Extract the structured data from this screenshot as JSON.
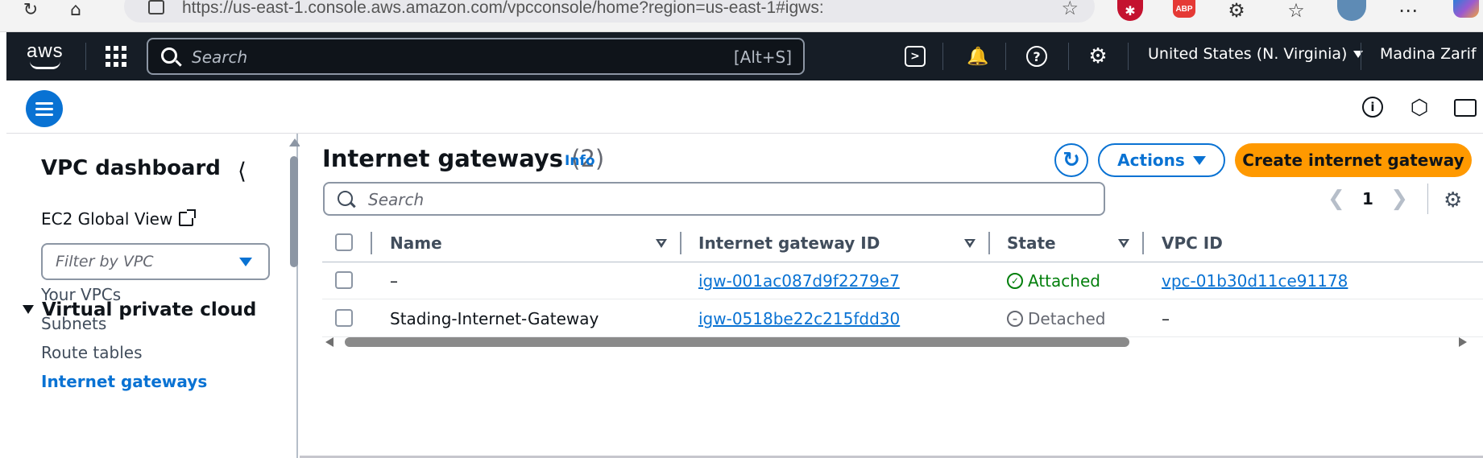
{
  "browser": {
    "url": "https://us-east-1.console.aws.amazon.com/vpcconsole/home?region=us-east-1#igws:",
    "abp_label": "ABP",
    "icons": [
      "refresh-icon",
      "home-icon",
      "site-info-icon",
      "favorite-star-icon",
      "extension-icon",
      "favorites-icon",
      "profile-avatar",
      "more-icon",
      "copilot-icon"
    ]
  },
  "topnav": {
    "logo": "aws",
    "search_placeholder": "Search",
    "search_shortcut": "[Alt+S]",
    "region": "United States (N. Virginia)",
    "user": "Madina Zarif"
  },
  "sidebar": {
    "title": "VPC dashboard",
    "ec2_global_view": "EC2 Global View",
    "filter_placeholder": "Filter by VPC",
    "section": "Virtual private cloud",
    "items": [
      {
        "label": "Your VPCs",
        "active": false
      },
      {
        "label": "Subnets",
        "active": false
      },
      {
        "label": "Route tables",
        "active": false
      },
      {
        "label": "Internet gateways",
        "active": true
      }
    ]
  },
  "main": {
    "title": "Internet gateways",
    "count": "(2)",
    "info": "Info",
    "actions_label": "Actions",
    "create_label": "Create internet gateway",
    "search_placeholder": "Search",
    "page": "1",
    "columns": [
      "Name",
      "Internet gateway ID",
      "State",
      "VPC ID"
    ],
    "rows": [
      {
        "name": "–",
        "igw_id": "igw-001ac087d9f2279e7",
        "state": "Attached",
        "state_icon": "check-circle-icon",
        "vpc_id": "vpc-01b30d11ce91178"
      },
      {
        "name": "Stading-Internet-Gateway",
        "igw_id": "igw-0518be22c215fdd30",
        "state": "Detached",
        "state_icon": "minus-circle-icon",
        "vpc_id": "–"
      }
    ]
  },
  "colors": {
    "nav_bg": "#161d26",
    "accent_blue": "#0972d3",
    "primary_orange": "#ff9900",
    "success_green": "#037f0c",
    "muted_grey": "#656871"
  }
}
